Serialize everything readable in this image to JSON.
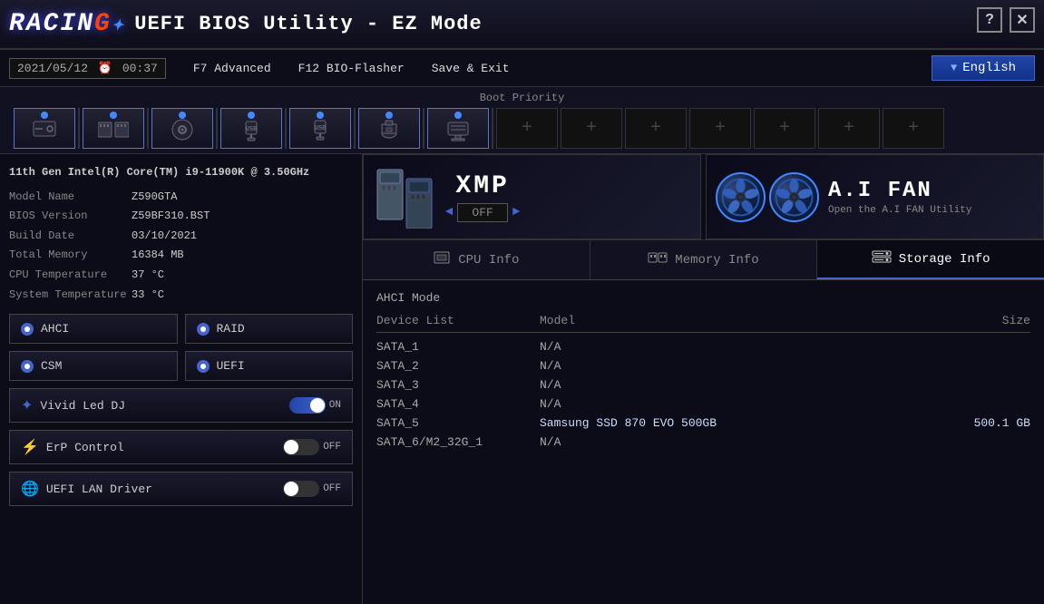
{
  "window": {
    "title": "UEFI BIOS Utility - EZ Mode",
    "help_label": "?",
    "close_label": "✕"
  },
  "header": {
    "logo": "RACING",
    "logo_suffix": "+",
    "title": "UEFI BIOS Utility - EZ Mode",
    "datetime": "2021/05/12",
    "time": "00:37",
    "nav": {
      "f7": "F7 Advanced",
      "f12": "F12 BIO-Flasher",
      "save": "Save & Exit"
    },
    "language": "English"
  },
  "boot_priority": {
    "label": "Boot Priority",
    "items": [
      {
        "id": "hdd",
        "icon": "💾",
        "active": true
      },
      {
        "id": "ram",
        "icon": "▬▬",
        "active": true
      },
      {
        "id": "dvd",
        "icon": "💿",
        "active": true
      },
      {
        "id": "usb1",
        "icon": "🔌",
        "active": true
      },
      {
        "id": "usb2",
        "icon": "🔌",
        "active": true
      },
      {
        "id": "usb3",
        "icon": "📀",
        "active": true
      },
      {
        "id": "net",
        "icon": "🖥",
        "active": true
      }
    ],
    "empty_slots": 7
  },
  "system": {
    "cpu": "11th Gen Intel(R) Core(TM) i9-11900K @ 3.50GHz",
    "model_label": "Model Name",
    "model_value": "Z590GTA",
    "bios_label": "BIOS Version",
    "bios_value": "Z59BF310.BST",
    "build_label": "Build Date",
    "build_value": "03/10/2021",
    "memory_label": "Total Memory",
    "memory_value": "16384 MB",
    "cpu_temp_label": "CPU Temperature",
    "cpu_temp_value": "37  °C",
    "sys_temp_label": "System Temperature",
    "sys_temp_value": "33  °C"
  },
  "xmp": {
    "title": "XMP",
    "status": "OFF"
  },
  "fan": {
    "title": "A.I FAN",
    "subtitle": "Open the A.I FAN Utility"
  },
  "tabs": {
    "cpu": "CPU Info",
    "memory": "Memory Info",
    "storage": "Storage Info",
    "active": "storage"
  },
  "storage": {
    "mode": "AHCI Mode",
    "col_device": "Device List",
    "col_model": "Model",
    "col_size": "Size",
    "devices": [
      {
        "name": "SATA_1",
        "model": "N/A",
        "size": ""
      },
      {
        "name": "SATA_2",
        "model": "N/A",
        "size": ""
      },
      {
        "name": "SATA_3",
        "model": "N/A",
        "size": ""
      },
      {
        "name": "SATA_4",
        "model": "N/A",
        "size": ""
      },
      {
        "name": "SATA_5",
        "model": "Samsung SSD 870 EVO 500GB",
        "size": "500.1 GB"
      },
      {
        "name": "SATA_6/M2_32G_1",
        "model": "N/A",
        "size": ""
      }
    ]
  },
  "controls": {
    "ahci": "AHCI",
    "raid": "RAID",
    "csm": "CSM",
    "uefi": "UEFI",
    "vivid_led": "Vivid Led DJ",
    "vivid_led_state": "ON",
    "erp": "ErP Control",
    "erp_state": "OFF",
    "uefi_lan": "UEFI LAN Driver",
    "uefi_lan_state": "OFF"
  },
  "colors": {
    "accent": "#4466cc",
    "active_text": "#ffffff",
    "inactive_text": "#888888",
    "bg_dark": "#0c0c18",
    "border": "#444444"
  }
}
